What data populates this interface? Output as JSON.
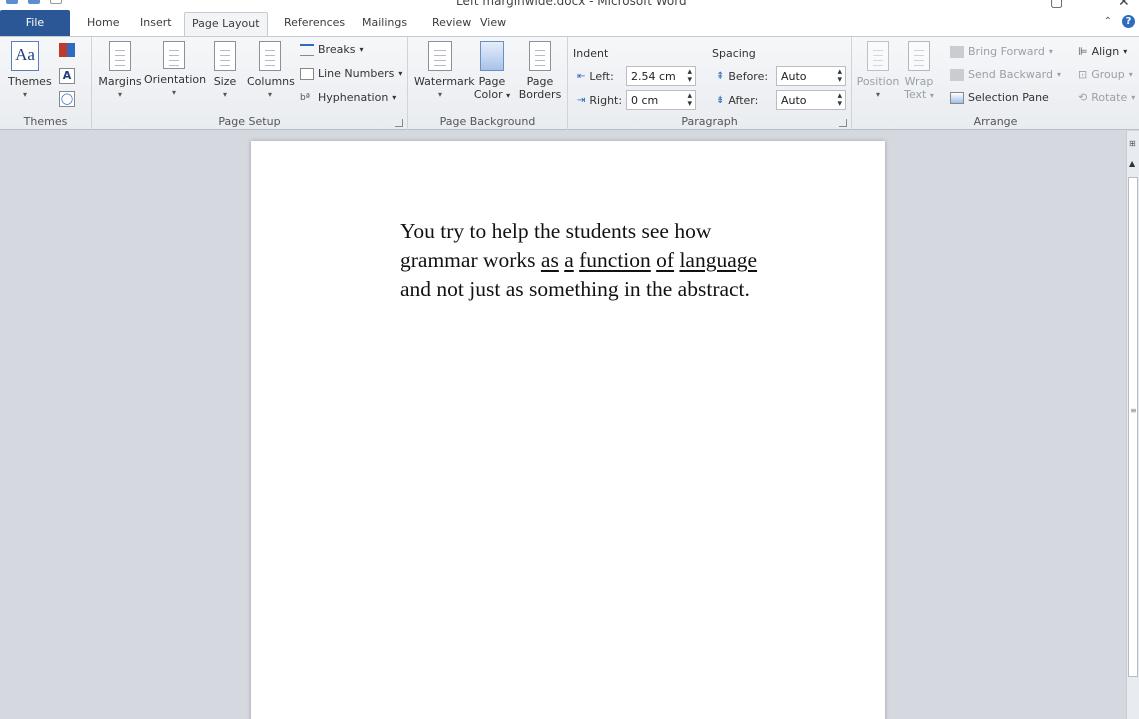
{
  "window": {
    "title": "Left marginwide.docx - Microsoft Word"
  },
  "tabs": [
    {
      "label": "File"
    },
    {
      "label": "Home"
    },
    {
      "label": "Insert"
    },
    {
      "label": "Page Layout"
    },
    {
      "label": "References"
    },
    {
      "label": "Mailings"
    },
    {
      "label": "Review"
    },
    {
      "label": "View"
    }
  ],
  "active_tab": "Page Layout",
  "ribbon": {
    "themes": {
      "label": "Themes",
      "group_label": "Themes"
    },
    "page_setup": {
      "margins": "Margins",
      "orientation": "Orientation",
      "size": "Size",
      "columns": "Columns",
      "breaks": "Breaks",
      "line_numbers": "Line Numbers",
      "hyphenation": "Hyphenation",
      "group_label": "Page Setup"
    },
    "page_background": {
      "watermark": "Watermark",
      "page_color_1": "Page",
      "page_color_2": "Color",
      "page_borders_1": "Page",
      "page_borders_2": "Borders",
      "group_label": "Page Background"
    },
    "paragraph": {
      "indent_heading": "Indent",
      "spacing_heading": "Spacing",
      "left_label": "Left:",
      "left_value": "2.54 cm",
      "right_label": "Right:",
      "right_value": "0 cm",
      "before_label": "Before:",
      "before_value": "Auto",
      "after_label": "After:",
      "after_value": "Auto",
      "group_label": "Paragraph"
    },
    "arrange": {
      "position": "Position",
      "wrap_text_1": "Wrap",
      "wrap_text_2": "Text",
      "bring_forward": "Bring Forward",
      "send_backward": "Send Backward",
      "selection_pane": "Selection Pane",
      "align": "Align",
      "group": "Group",
      "rotate": "Rotate",
      "group_label": "Arrange"
    }
  },
  "document": {
    "parts": [
      {
        "text": "You try to help the students see how grammar works ",
        "underline": false
      },
      {
        "text": "as",
        "underline": true
      },
      {
        "text": " ",
        "underline": false
      },
      {
        "text": "a",
        "underline": true
      },
      {
        "text": " ",
        "underline": false
      },
      {
        "text": "function",
        "underline": true
      },
      {
        "text": " ",
        "underline": false
      },
      {
        "text": "of",
        "underline": true
      },
      {
        "text": " ",
        "underline": false
      },
      {
        "text": "language",
        "underline": true
      },
      {
        "text": " and not just as something in the abstract.",
        "underline": false
      }
    ]
  },
  "colors": {
    "file_tab": "#2b5797",
    "workspace": "#d5d9df",
    "ribbon": "#f3f4f6"
  }
}
